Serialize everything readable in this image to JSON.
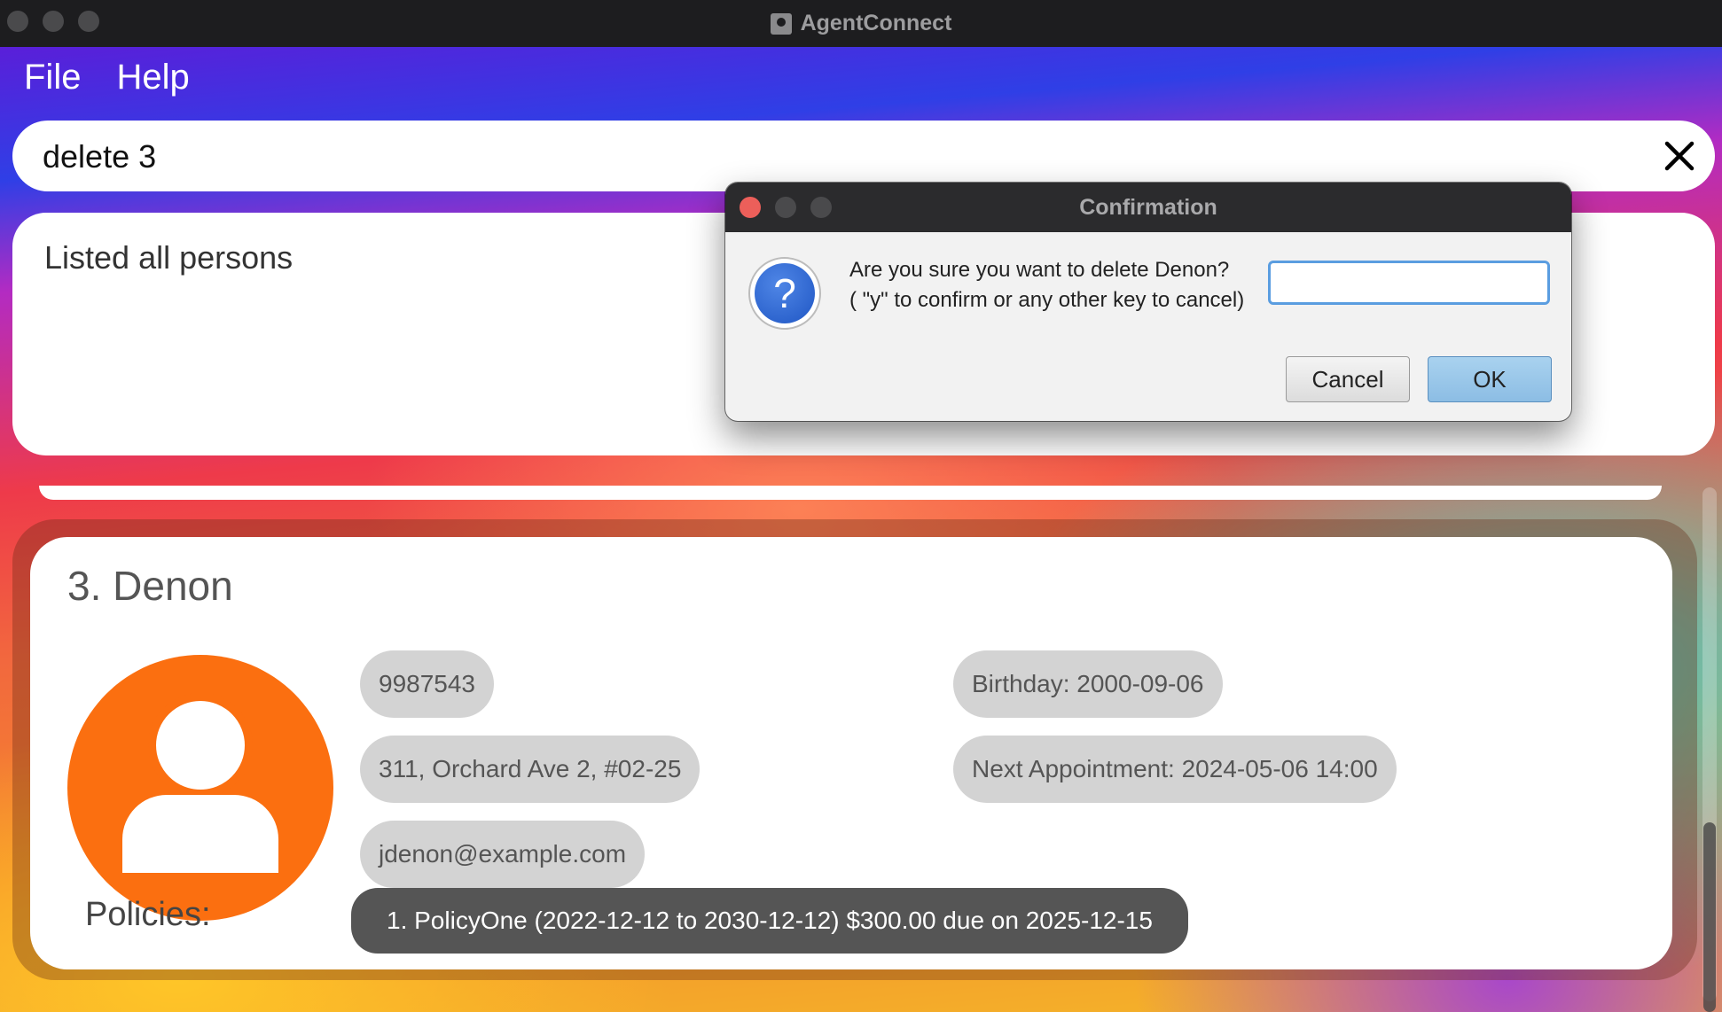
{
  "window": {
    "title": "AgentConnect"
  },
  "menu": {
    "items": [
      "File",
      "Help"
    ]
  },
  "command": {
    "value": "delete 3"
  },
  "result": {
    "text": "Listed all persons"
  },
  "dialog": {
    "title": "Confirmation",
    "message_line1": "Are you sure you want to delete Denon?",
    "message_line2": "( \"y\" to confirm or any other key to cancel)",
    "input_value": "",
    "cancel_label": "Cancel",
    "ok_label": "OK"
  },
  "person": {
    "name": "3. Denon",
    "phone": "9987543",
    "address": "311, Orchard Ave 2, #02-25",
    "email": "jdenon@example.com",
    "birthday": "Birthday: 2000-09-06",
    "appointment": "Next Appointment: 2024-05-06 14:00",
    "policies_label": "Policies:",
    "policies": [
      "1. PolicyOne (2022-12-12 to 2030-12-12) $300.00 due on 2025-12-15"
    ],
    "avatar_color": "#fb6f10"
  },
  "icons": {
    "clear": "close-icon",
    "question": "question-icon",
    "avatar": "user-icon"
  },
  "colors": {
    "ok_button": "#a9d2ef",
    "dialog_close_dot": "#ec5f5a",
    "policy_chip": "#555555",
    "info_chip": "#d3d3d3"
  }
}
